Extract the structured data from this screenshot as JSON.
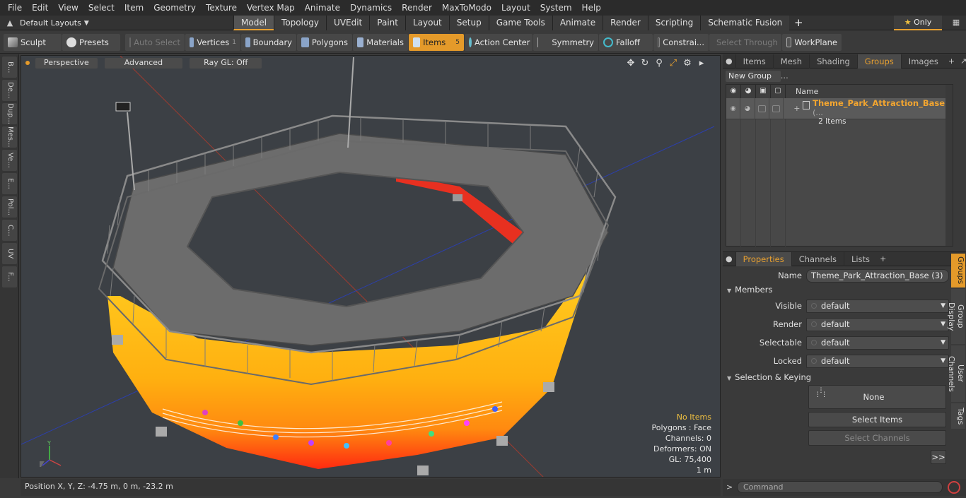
{
  "menu": [
    "File",
    "Edit",
    "View",
    "Select",
    "Item",
    "Geometry",
    "Texture",
    "Vertex Map",
    "Animate",
    "Dynamics",
    "Render",
    "MaxToModo",
    "Layout",
    "System",
    "Help"
  ],
  "layout_selector": "Default Layouts",
  "tabs": [
    "Model",
    "Topology",
    "UVEdit",
    "Paint",
    "Layout",
    "Setup",
    "Game Tools",
    "Animate",
    "Render",
    "Scripting",
    "Schematic Fusion"
  ],
  "active_tab": "Model",
  "only_label": "Only",
  "toolbar": {
    "sculpt": "Sculpt",
    "presets": "Presets",
    "auto_select": "Auto Select",
    "vertices": "Vertices",
    "vertices_count": "1",
    "boundary": "Boundary",
    "polygons": "Polygons",
    "materials": "Materials",
    "items": "Items",
    "items_count": "5",
    "action_center": "Action Center",
    "symmetry": "Symmetry",
    "falloff": "Falloff",
    "constraints": "Constrai...",
    "select_through": "Select Through",
    "workplane": "WorkPlane"
  },
  "left_tabs": [
    "B...",
    "De...",
    "Dup...",
    "Mes...",
    "Ve...",
    "E...",
    "Pol...",
    "C...",
    "UV",
    "F..."
  ],
  "viewport": {
    "perspective": "Perspective",
    "advanced": "Advanced",
    "raygl": "Ray GL: Off",
    "stats": {
      "no_items": "No Items",
      "polygons": "Polygons : Face",
      "channels": "Channels: 0",
      "deformers": "Deformers: ON",
      "gl": "GL: 75,400",
      "scale": "1 m"
    }
  },
  "status": "Position X, Y, Z:   -4.75 m, 0 m, -23.2 m",
  "right_tabs": [
    "Items",
    "Mesh ...",
    "Shading",
    "Groups",
    "Images"
  ],
  "active_right_tab": "Groups",
  "new_group": "New Group",
  "group_list": {
    "name_header": "Name",
    "group_name": "Theme_Park_Attraction_Base",
    "group_suffix": "(...",
    "group_count": "2 Items"
  },
  "props_tabs": [
    "Properties",
    "Channels",
    "Lists"
  ],
  "properties": {
    "name_label": "Name",
    "name_value": "Theme_Park_Attraction_Base (3)",
    "members": "Members",
    "visible_label": "Visible",
    "render_label": "Render",
    "selectable_label": "Selectable",
    "locked_label": "Locked",
    "default": "default",
    "selection_keying": "Selection & Keying",
    "none": "None",
    "select_items": "Select Items",
    "select_channels": "Select Channels",
    "more": ">>"
  },
  "side_tabs": [
    "Groups",
    "Group Display",
    "User Channels",
    "Tags"
  ],
  "command_placeholder": "Command",
  "colors": {
    "accent": "#e49a2a",
    "selected_group": "#f2a530"
  }
}
